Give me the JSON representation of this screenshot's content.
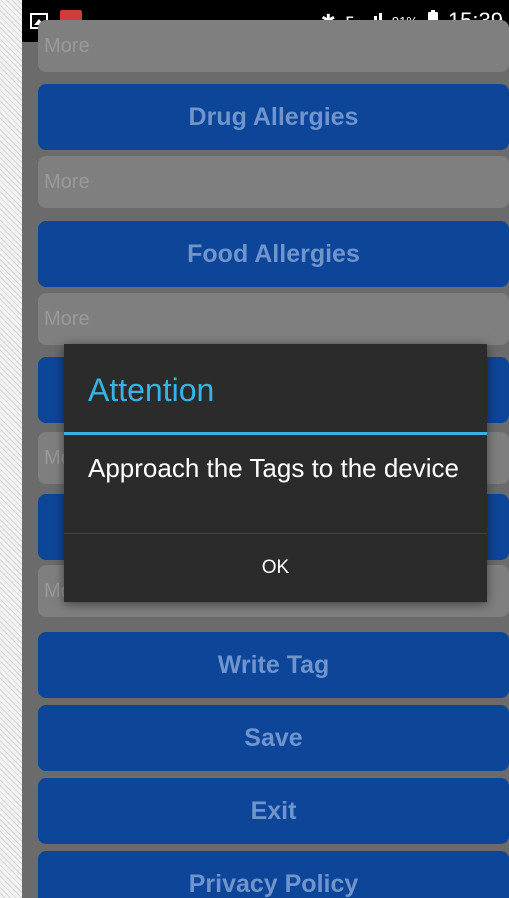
{
  "status_bar": {
    "bluetooth_icon": "bluetooth-icon",
    "network_type": "E",
    "battery_percent": "91%",
    "time": "15:39"
  },
  "form": {
    "more_placeholder": "More",
    "drug_allergies_label": "Drug Allergies",
    "food_allergies_label": "Food Allergies",
    "write_tag_label": "Write Tag",
    "save_label": "Save",
    "exit_label": "Exit",
    "privacy_policy_label": "Privacy Policy"
  },
  "dialog": {
    "title": "Attention",
    "message": "Approach the Tags to the device",
    "ok_label": "OK"
  },
  "colors": {
    "button_blue": "#0d4599",
    "button_text": "#6f95cc",
    "dialog_accent": "#35b5e5",
    "dialog_bg": "#2b2b2b"
  }
}
